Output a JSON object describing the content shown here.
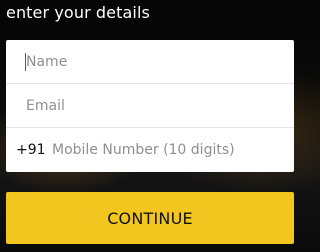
{
  "header": {
    "title": "enter your details"
  },
  "form": {
    "name": {
      "value": "",
      "placeholder": "Name"
    },
    "email": {
      "value": "",
      "placeholder": "Email"
    },
    "mobile": {
      "country_code": "+91",
      "value": "",
      "placeholder": "Mobile Number (10 digits)"
    }
  },
  "actions": {
    "continue_label": "CONTINUE"
  },
  "colors": {
    "accent": "#f2c61f",
    "caret": "#0f7b7a",
    "background": "#0b0b0b"
  }
}
